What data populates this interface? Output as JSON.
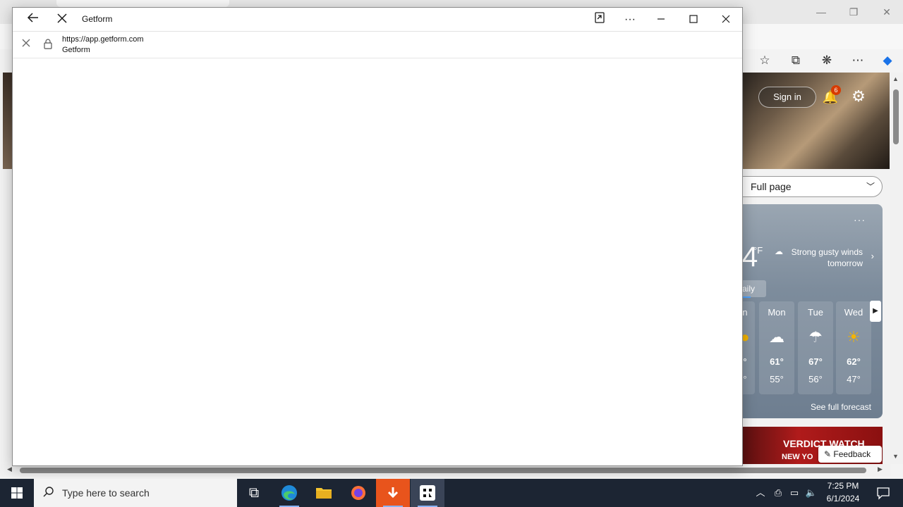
{
  "popup": {
    "title": "Getform",
    "url": "https://app.getform.com",
    "site_name": "Getform",
    "icons": {
      "back": "back-arrow-icon",
      "stop": "stop-loading-icon",
      "open_in_browser": "open-in-browser-icon",
      "more": "more-options-icon",
      "minimize": "minimize-icon",
      "maximize": "maximize-icon",
      "close": "close-icon",
      "lock": "lock-icon"
    }
  },
  "background_page": {
    "signin_label": "Sign in",
    "notification_count": "6",
    "layout_select": "Full page",
    "weather": {
      "temp_fragment": "4",
      "unit": "°F",
      "condition_line1": "Strong gusty winds",
      "condition_line2": "tomorrow",
      "tab_label": "aily",
      "partial_day": "n",
      "partial_hi": "°",
      "partial_lo": "°",
      "days": [
        {
          "name": "Mon",
          "hi": "61°",
          "lo": "55°"
        },
        {
          "name": "Tue",
          "hi": "67°",
          "lo": "56°"
        },
        {
          "name": "Wed",
          "hi": "62°",
          "lo": "47°"
        }
      ],
      "see_full": "See full forecast"
    },
    "news": {
      "headline": "VERDICT WATCH",
      "sub": "NEW YO"
    },
    "feedback_label": "Feedback"
  },
  "taskbar": {
    "search_placeholder": "Type here to search",
    "time": "7:25 PM",
    "date": "6/1/2024"
  },
  "colors": {
    "taskbar_bg": "#1c2533",
    "accent": "#0078d4",
    "badge": "#d83b01"
  }
}
